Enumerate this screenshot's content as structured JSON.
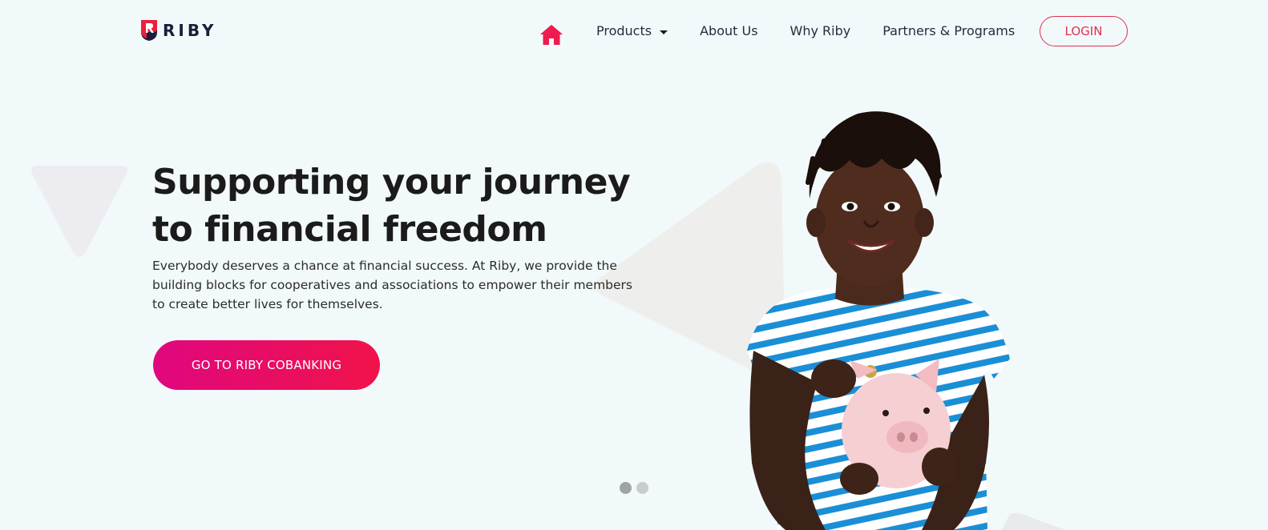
{
  "brand": {
    "name": "RIBY",
    "primary_color": "#e0314f",
    "accent_gradient": [
      "#e0077f",
      "#f0134a"
    ],
    "logo_icon": "riby-shield-logo-icon"
  },
  "nav": {
    "home_icon": "home-icon",
    "products_label": "Products",
    "about_label": "About Us",
    "why_label": "Why Riby",
    "partners_label": "Partners & Programs",
    "login_label": "LOGIN"
  },
  "hero": {
    "title": "Supporting your journey to financial freedom",
    "description": "Everybody deserves a chance at financial success. At Riby, we provide the building blocks for cooperatives and associations to empower their members to create better lives for themselves.",
    "cta_label": "GO TO RIBY COBANKING"
  },
  "carousel": {
    "slide_count": 2,
    "active_slide": 1
  }
}
